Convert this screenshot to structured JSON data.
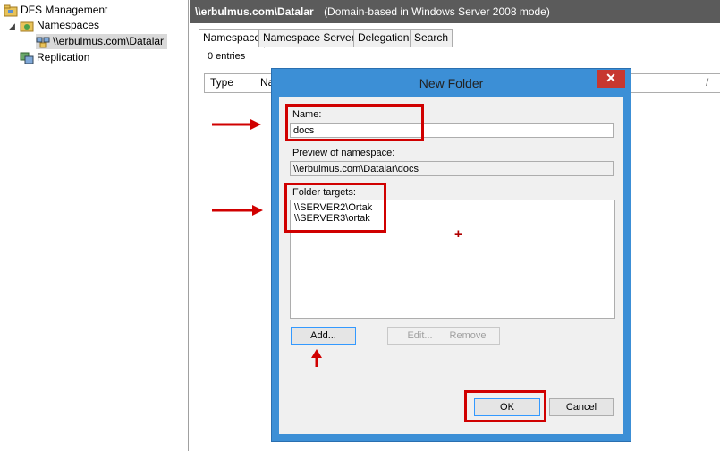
{
  "tree": {
    "root_label": "DFS Management",
    "namespaces_label": "Namespaces",
    "namespace_item_label": "\\\\erbulmus.com\\Datalar",
    "replication_label": "Replication"
  },
  "header": {
    "path": "\\\\erbulmus.com\\Datalar",
    "mode": "(Domain-based in Windows Server 2008 mode)"
  },
  "tabs": [
    {
      "label": "Namespace"
    },
    {
      "label": "Namespace Servers"
    },
    {
      "label": "Delegation"
    },
    {
      "label": "Search"
    }
  ],
  "entries_label": "0 entries",
  "list_columns": [
    "Type",
    "Na"
  ],
  "dialog": {
    "title": "New Folder",
    "close_glyph": "✕",
    "name_label": "Name:",
    "name_value": "docs",
    "preview_label": "Preview of namespace:",
    "preview_value": "\\\\erbulmus.com\\Datalar\\docs",
    "targets_label": "Folder targets:",
    "targets": [
      "\\\\SERVER2\\Ortak",
      "\\\\SERVER3\\ortak"
    ],
    "add_label": "Add...",
    "edit_label": "Edit...",
    "remove_label": "Remove",
    "ok_label": "OK",
    "cancel_label": "Cancel"
  },
  "colors": {
    "highlight": "#d00000",
    "dialog_frame": "#3c8fd6",
    "close_button": "#c7372f"
  }
}
